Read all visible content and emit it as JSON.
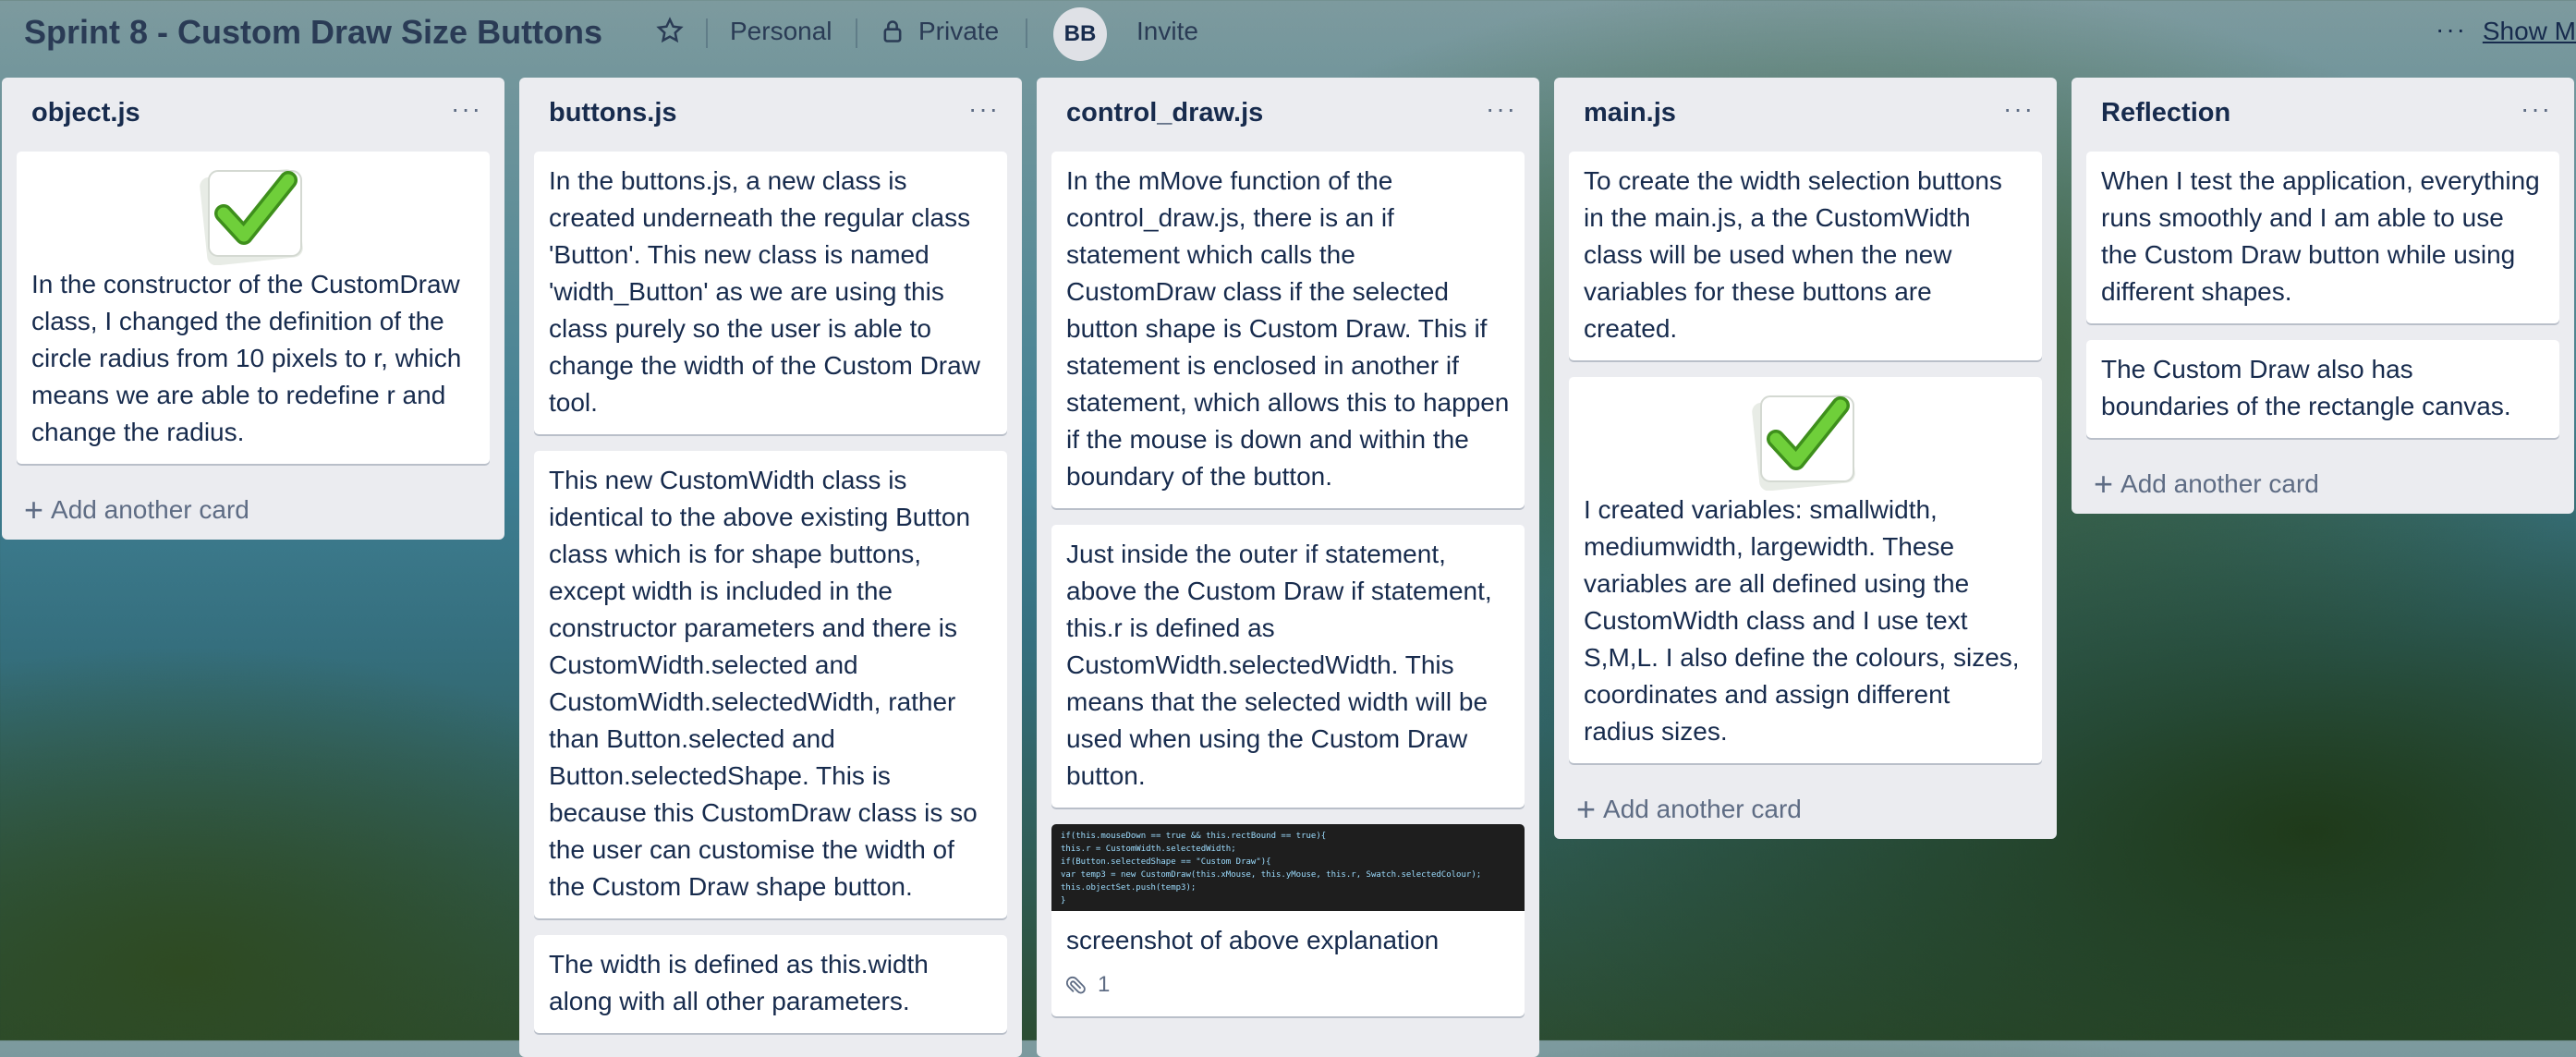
{
  "header": {
    "title": "Sprint 8 - Custom Draw Size Buttons",
    "team": "Personal",
    "visibility": "Private",
    "avatar_initials": "BB",
    "invite": "Invite",
    "more": "···",
    "show_menu": "Show M"
  },
  "lists": [
    {
      "title": "object.js",
      "cards": [
        {
          "text": "In the constructor of the CustomDraw class, I changed the definition of the circle radius from 10 pixels to r, which means we are able to redefine r and change the radius."
        }
      ],
      "add_card": "Add another card"
    },
    {
      "title": "buttons.js",
      "cards": [
        {
          "text": "In the buttons.js, a new class is created underneath the regular class 'Button'. This new class is named 'width_Button' as we are using this class purely so the user is able to change the width of the Custom Draw tool."
        },
        {
          "text": "This new CustomWidth class is identical to the above existing Button class which is for shape buttons, except width is included in the constructor parameters and there is CustomWidth.selected and CustomWidth.selectedWidth, rather than Button.selected and Button.selectedShape. This is because this CustomDraw class is so the user can customise the width of the Custom Draw shape button."
        },
        {
          "text": "The width is defined as this.width along with all other parameters."
        }
      ]
    },
    {
      "title": "control_draw.js",
      "cards": [
        {
          "text": "In the mMove function of the control_draw.js, there is an if statement which calls the CustomDraw class if the selected button shape is Custom Draw. This if statement is enclosed in another if statement, which allows this to happen if the mouse is down and within the boundary of the button."
        },
        {
          "text": "Just inside the outer if statement, above the Custom Draw if statement, this.r is defined as CustomWidth.selectedWidth. This means that the selected width will be used when using the Custom Draw button."
        },
        {
          "text": "screenshot of above explanation",
          "attachments": "1",
          "code_lines": [
            "if(this.mouseDown == true && this.rectBound == true){",
            "   this.r = CustomWidth.selectedWidth;",
            "   if(Button.selectedShape == \"Custom Draw\"){",
            "      var temp3 = new CustomDraw(this.xMouse, this.yMouse, this.r, Swatch.selectedColour);",
            "      this.objectSet.push(temp3);",
            "   }"
          ]
        }
      ]
    },
    {
      "title": "main.js",
      "cards": [
        {
          "text": "To create the width selection buttons in the main.js, a the CustomWidth class will be used when the new variables for these buttons are created."
        },
        {
          "text": "I created variables: smallwidth, mediumwidth, largewidth. These variables are all defined using the CustomWidth class and I use text S,M,L. I also define the colours, sizes, coordinates and assign different radius sizes."
        }
      ],
      "add_card": "Add another card"
    },
    {
      "title": "Reflection",
      "cards": [
        {
          "text": "When I test the application, everything runs smoothly and I am able to use the Custom Draw button while using different shapes."
        },
        {
          "text": "The Custom Draw also has boundaries of the rectangle canvas."
        }
      ],
      "add_card": "Add another card"
    }
  ],
  "list_menu": "···",
  "colors": {
    "list_bg": "#ebecf0",
    "card_bg": "#ffffff",
    "text": "#172b4d",
    "check_green": "#5cb531"
  }
}
